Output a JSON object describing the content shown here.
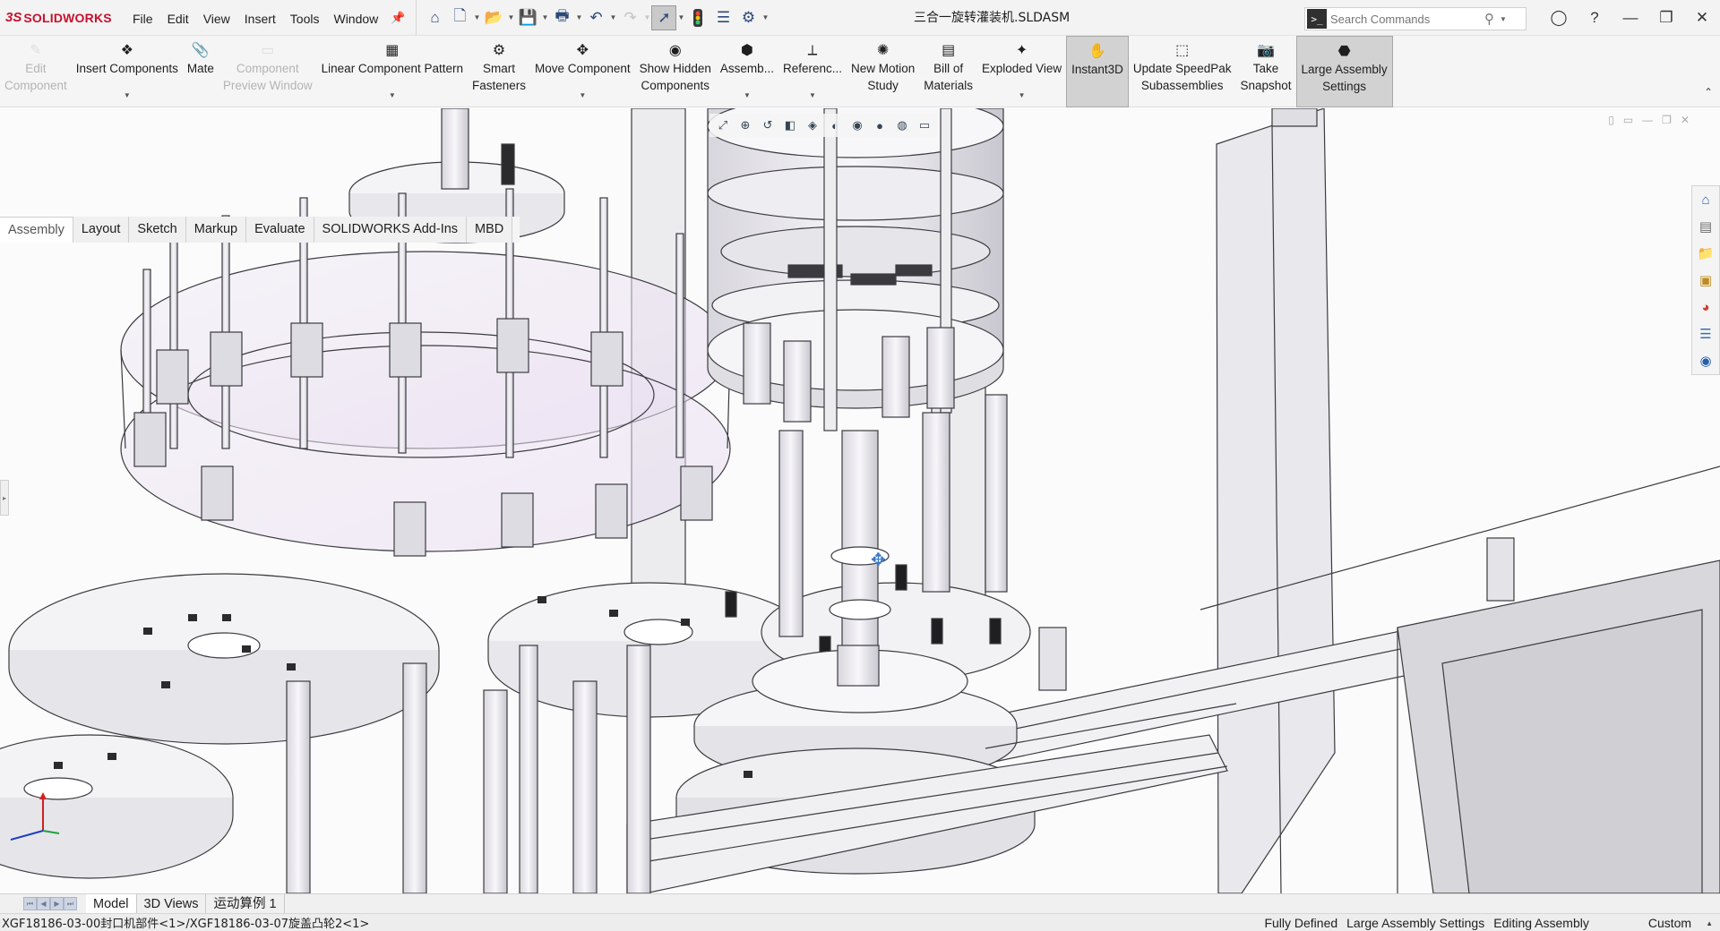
{
  "app": {
    "logo_mark": "3S",
    "brand": "SOLIDWORKS",
    "document_title": "三合一旋转灌装机.SLDASM"
  },
  "menu": [
    "File",
    "Edit",
    "View",
    "Insert",
    "Tools",
    "Window"
  ],
  "quick_access": [
    {
      "name": "home-icon"
    },
    {
      "name": "new-document-icon"
    },
    {
      "name": "open-folder-icon"
    },
    {
      "name": "save-icon"
    },
    {
      "name": "print-icon"
    },
    {
      "name": "undo-icon"
    },
    {
      "name": "redo-icon"
    },
    {
      "name": "select-arrow-icon"
    },
    {
      "name": "rebuild-traffic-light-icon"
    },
    {
      "name": "file-properties-icon"
    },
    {
      "name": "options-gear-icon"
    }
  ],
  "search": {
    "placeholder": "Search Commands"
  },
  "command_manager": [
    {
      "name": "edit-component",
      "label1": "Edit",
      "label2": "Component",
      "state": "disabled",
      "icon": "✎"
    },
    {
      "name": "insert-components",
      "label1": "Insert Components",
      "label2": "",
      "state": "normal",
      "icon": "❖",
      "dropdown": true
    },
    {
      "name": "mate",
      "label1": "Mate",
      "label2": "",
      "state": "normal",
      "icon": "📎"
    },
    {
      "name": "component-preview-window",
      "label1": "Component",
      "label2": "Preview Window",
      "state": "disabled",
      "icon": "▭"
    },
    {
      "name": "linear-component-pattern",
      "label1": "Linear Component Pattern",
      "label2": "",
      "state": "normal",
      "icon": "▦",
      "dropdown": true
    },
    {
      "name": "smart-fasteners",
      "label1": "Smart",
      "label2": "Fasteners",
      "state": "normal",
      "icon": "⚙"
    },
    {
      "name": "move-component",
      "label1": "Move Component",
      "label2": "",
      "state": "normal",
      "icon": "✥",
      "dropdown": true
    },
    {
      "name": "show-hidden-components",
      "label1": "Show Hidden",
      "label2": "Components",
      "state": "normal",
      "icon": "◉"
    },
    {
      "name": "assembly-features",
      "label1": "Assemb...",
      "label2": "",
      "state": "normal",
      "icon": "⬢",
      "dropdown": true
    },
    {
      "name": "reference-geometry",
      "label1": "Referenc...",
      "label2": "",
      "state": "normal",
      "icon": "⟂",
      "dropdown": true
    },
    {
      "name": "new-motion-study",
      "label1": "New Motion",
      "label2": "Study",
      "state": "normal",
      "icon": "✺"
    },
    {
      "name": "bill-of-materials",
      "label1": "Bill of",
      "label2": "Materials",
      "state": "normal",
      "icon": "▤"
    },
    {
      "name": "exploded-view",
      "label1": "Exploded View",
      "label2": "",
      "state": "normal",
      "icon": "✦",
      "dropdown": true
    },
    {
      "name": "instant3d",
      "label1": "Instant3D",
      "label2": "",
      "state": "active",
      "icon": "✋"
    },
    {
      "name": "update-speedpak",
      "label1": "Update SpeedPak",
      "label2": "Subassemblies",
      "state": "normal",
      "icon": "⬚"
    },
    {
      "name": "take-snapshot",
      "label1": "Take",
      "label2": "Snapshot",
      "state": "normal",
      "icon": "📷"
    },
    {
      "name": "large-assembly-settings",
      "label1": "Large Assembly",
      "label2": "Settings",
      "state": "active",
      "icon": "⬣"
    }
  ],
  "tabs": [
    {
      "label": "Assembly",
      "active": true
    },
    {
      "label": "Layout",
      "active": false
    },
    {
      "label": "Sketch",
      "active": false
    },
    {
      "label": "Markup",
      "active": false
    },
    {
      "label": "Evaluate",
      "active": false
    },
    {
      "label": "SOLIDWORKS Add-Ins",
      "active": false
    },
    {
      "label": "MBD",
      "active": false
    }
  ],
  "bottom_tabs": [
    {
      "label": "Model",
      "active": true
    },
    {
      "label": "3D Views",
      "active": false
    },
    {
      "label": "运动算例 1",
      "active": false
    }
  ],
  "status": {
    "path": "XGF18186-03-00封口机部件<1>/XGF18186-03-07旋盖凸轮2<1>",
    "definition": "Fully Defined",
    "mode_setting": "Large Assembly Settings",
    "editing": "Editing Assembly",
    "units": "Custom"
  },
  "colors": {
    "brand_red": "#c8102e",
    "ribbon_bg": "#f5f5f5",
    "active_button": "#d2d2d2",
    "viewport_bg": "#fbfbfb"
  }
}
